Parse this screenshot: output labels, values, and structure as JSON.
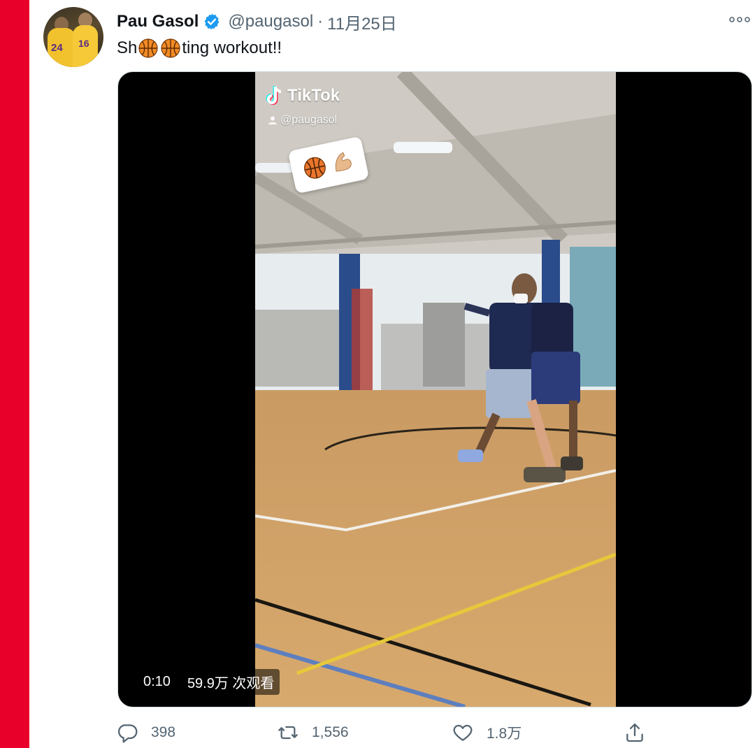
{
  "tweet": {
    "author_name": "Pau Gasol",
    "handle": "@paugasol",
    "separator": "·",
    "date": "11月25日",
    "text_prefix": "Sh",
    "text_suffix": "ting workout!!",
    "avatar_numbers": [
      "24",
      "16"
    ]
  },
  "video": {
    "watermark_brand": "TikTok",
    "watermark_user": "@paugasol",
    "duration": "0:10",
    "views": "59.9万 次观看"
  },
  "actions": {
    "replies": "398",
    "retweets": "1,556",
    "likes": "1.8万"
  },
  "colors": {
    "accent_red": "#e8002a",
    "verified_blue": "#1d9bf0",
    "muted_text": "#536471"
  }
}
